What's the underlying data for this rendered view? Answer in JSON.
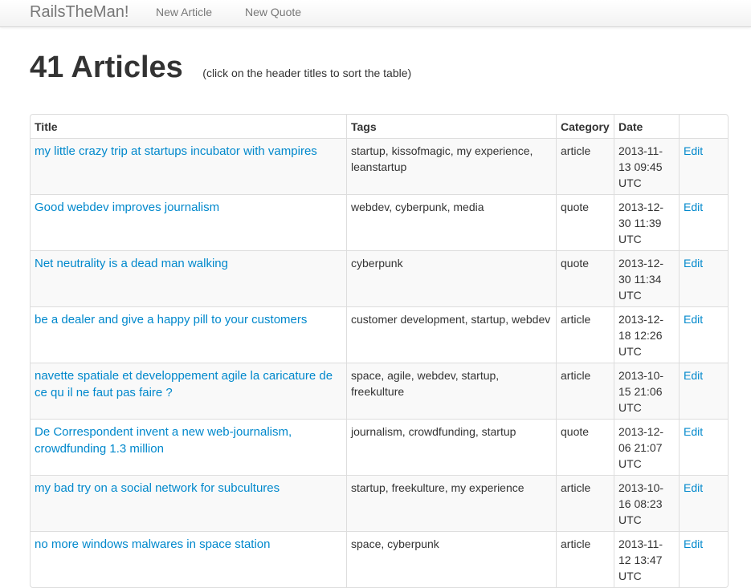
{
  "navbar": {
    "brand": "RailsTheMan!",
    "links": [
      "New Article",
      "New Quote"
    ]
  },
  "header": {
    "title": "41 Articles",
    "hint": "(click on the header titles to sort the table)"
  },
  "table": {
    "columns": [
      "Title",
      "Tags",
      "Category",
      "Date",
      ""
    ],
    "edit_label": "Edit",
    "rows": [
      {
        "title": "my little crazy trip at startups incubator with vampires",
        "tags": "startup, kissofmagic, my experience, leanstartup",
        "category": "article",
        "date": "2013-11-13 09:45 UTC"
      },
      {
        "title": "Good webdev improves journalism",
        "tags": "webdev, cyberpunk, media",
        "category": "quote",
        "date": "2013-12-30 11:39 UTC"
      },
      {
        "title": "Net neutrality is a dead man walking",
        "tags": "cyberpunk",
        "category": "quote",
        "date": "2013-12-30 11:34 UTC"
      },
      {
        "title": "be a dealer and give a happy pill to your customers",
        "tags": "customer development, startup, webdev",
        "category": "article",
        "date": "2013-12-18 12:26 UTC"
      },
      {
        "title": "navette spatiale et developpement agile la caricature de ce qu il ne faut pas faire ?",
        "tags": "space, agile, webdev, startup, freekulture",
        "category": "article",
        "date": "2013-10-15 21:06 UTC"
      },
      {
        "title": "De Correspondent invent a new web-journalism, crowdfunding 1.3 million",
        "tags": "journalism, crowdfunding, startup",
        "category": "quote",
        "date": "2013-12-06 21:07 UTC"
      },
      {
        "title": "my bad try on a social network for subcultures",
        "tags": "startup, freekulture, my experience",
        "category": "article",
        "date": "2013-10-16 08:23 UTC"
      },
      {
        "title": "no more windows malwares in space station",
        "tags": "space, cyberpunk",
        "category": "article",
        "date": "2013-11-12 13:47 UTC"
      }
    ]
  },
  "colors": {
    "link": "#0088cc",
    "text": "#333333",
    "nav_text": "#777777",
    "border": "#dddddd",
    "stripe": "#f9f9f9"
  }
}
